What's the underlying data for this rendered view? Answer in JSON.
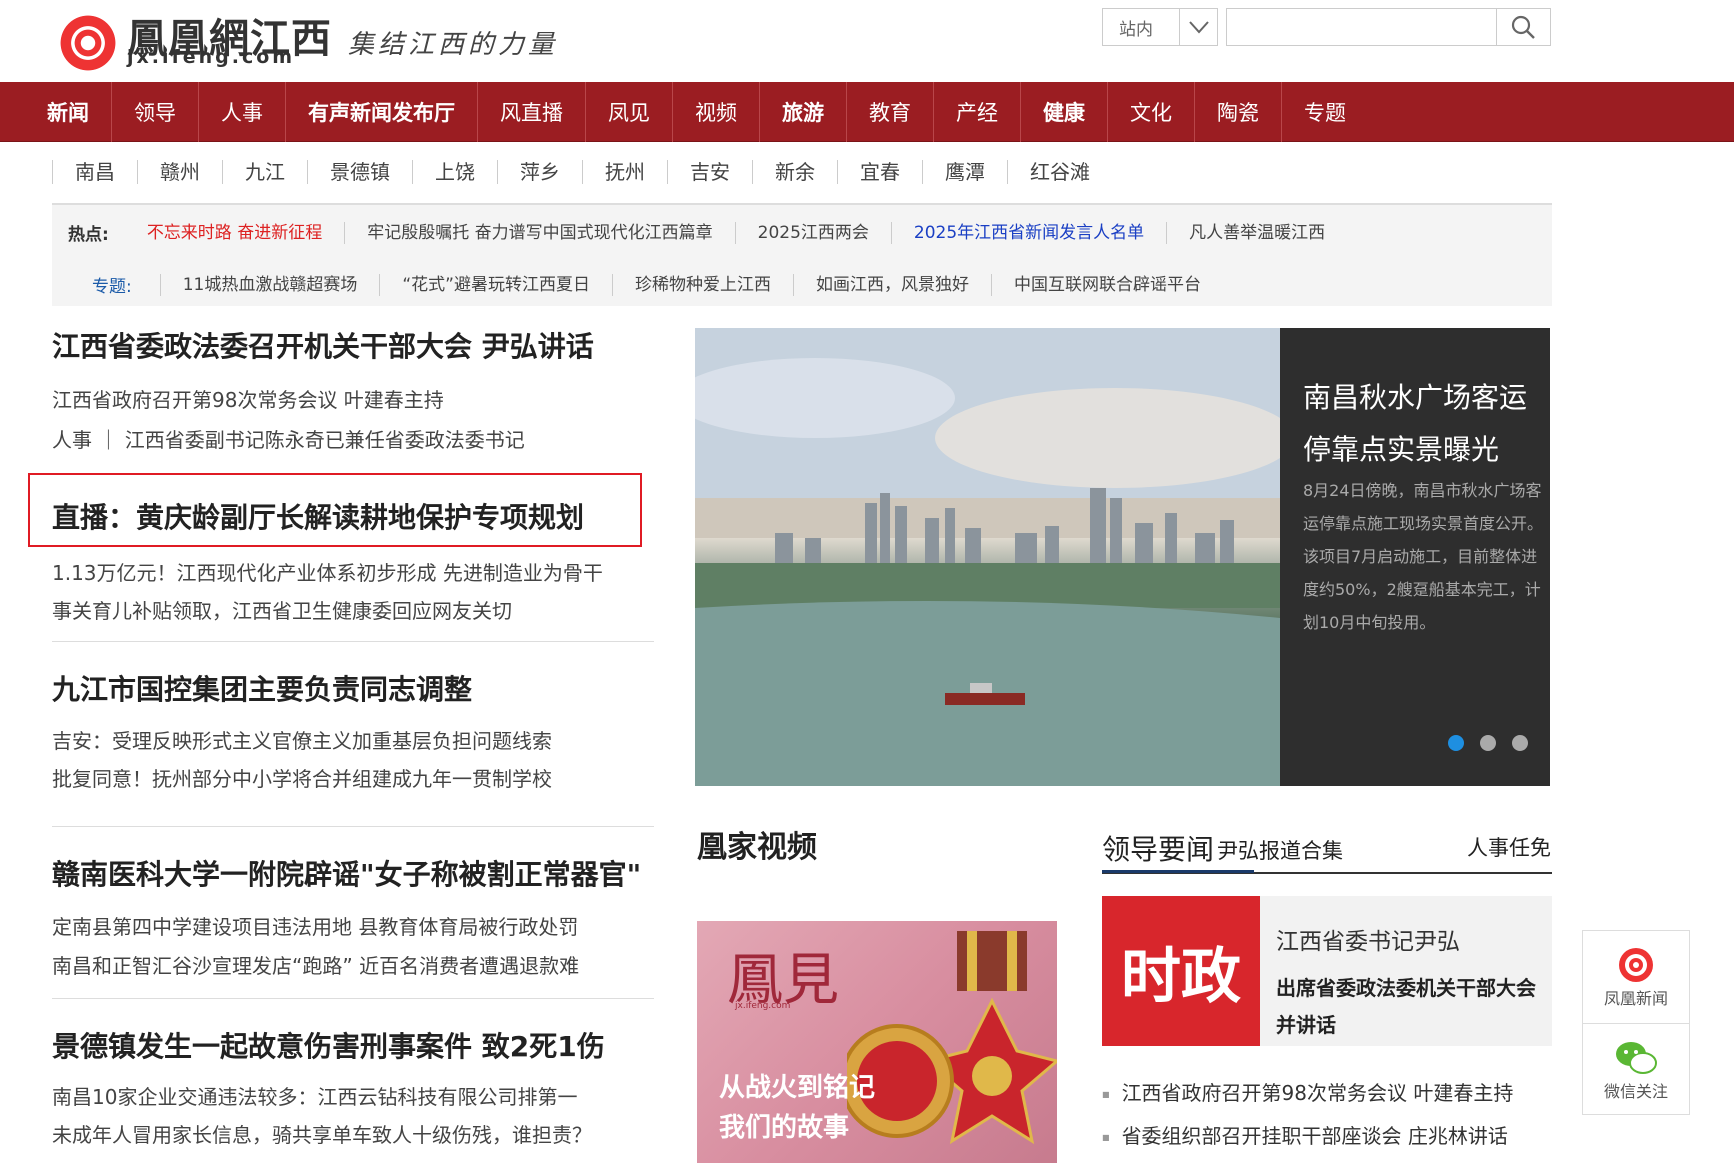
{
  "header": {
    "logo_name": "鳳凰網江西",
    "logo_domain": "jx.ifeng.com",
    "slogan": "集结江西的力量",
    "search_scope": "站内",
    "search_placeholder": ""
  },
  "main_nav": [
    {
      "label": "新闻",
      "bold": true
    },
    {
      "label": "领导",
      "bold": false
    },
    {
      "label": "人事",
      "bold": false
    },
    {
      "label": "有声新闻发布厅",
      "bold": true
    },
    {
      "label": "风直播",
      "bold": false
    },
    {
      "label": "凤见",
      "bold": false
    },
    {
      "label": "视频",
      "bold": false
    },
    {
      "label": "旅游",
      "bold": true
    },
    {
      "label": "教育",
      "bold": false
    },
    {
      "label": "产经",
      "bold": false
    },
    {
      "label": "健康",
      "bold": true
    },
    {
      "label": "文化",
      "bold": false
    },
    {
      "label": "陶瓷",
      "bold": false
    },
    {
      "label": "专题",
      "bold": false
    }
  ],
  "city_nav": [
    "南昌",
    "赣州",
    "九江",
    "景德镇",
    "上饶",
    "萍乡",
    "抚州",
    "吉安",
    "新余",
    "宜春",
    "鹰潭",
    "红谷滩"
  ],
  "hot": {
    "label": "热点:",
    "items": [
      "不忘来时路 奋进新征程",
      "牢记殷殷嘱托 奋力谱写中国式现代化江西篇章",
      "2025江西两会",
      "2025年江西省新闻发言人名单",
      "凡人善举温暖江西"
    ]
  },
  "topics": {
    "label": "专题:",
    "items": [
      "11城热血激战赣超赛场",
      "“花式”避暑玩转江西夏日",
      "珍稀物种爱上江西",
      "如画江西，风景独好",
      "中国互联网联合辟谣平台"
    ]
  },
  "news_blocks": [
    {
      "headline": "江西省委政法委召开机关干部大会 尹弘讲话",
      "subs": [
        "江西省政府召开第98次常务会议 叶建春主持",
        "人事 ｜ 江西省委副书记陈永奇已兼任省委政法委书记"
      ]
    },
    {
      "headline": "直播：黄庆龄副厅长解读耕地保护专项规划",
      "subs": [
        "1.13万亿元！江西现代化产业体系初步形成 先进制造业为骨干",
        "事关育儿补贴领取，江西省卫生健康委回应网友关切"
      ]
    },
    {
      "headline": "九江市国控集团主要负责同志调整",
      "subs": [
        "吉安：受理反映形式主义官僚主义加重基层负担问题线索",
        "批复同意！抚州部分中小学将合并组建成九年一贯制学校"
      ]
    },
    {
      "headline": "赣南医科大学一附院辟谣\"女子称被割正常器官\"",
      "subs": [
        "定南县第四中学建设项目违法用地 县教育体育局被行政处罚",
        "南昌和正智汇谷沙宣理发店“跑路” 近百名消费者遭遇退款难"
      ]
    },
    {
      "headline": "景德镇发生一起故意伤害刑事案件 致2死1伤",
      "subs": [
        "南昌10家企业交通违法较多：江西云钻科技有限公司排第一",
        "未成年人冒用家长信息，骑共享单车致人十级伤残，谁担责？"
      ]
    }
  ],
  "slider": {
    "title": "南昌秋水广场客运停靠点实景曝光",
    "desc": "8月24日傍晚，南昌市秋水广场客运停靠点施工现场实景首度公开。该项目7月启动施工，目前整体进度约50%，2艘趸船基本完工，计划10月中旬投用。",
    "active_dot": 0
  },
  "video": {
    "section_title": "凰家视频",
    "brand": "鳳見",
    "brand_domain": "jx.ifeng.com",
    "caption_1": "从战火到铭记",
    "caption_2": "我们的故事"
  },
  "leaders": {
    "title": "领导要闻",
    "sub": "尹弘报道合集",
    "more": "人事任免",
    "badge": "时政",
    "name": "江西省委书记尹弘",
    "event": "出席省委政法委机关干部大会并讲话",
    "links": [
      "江西省政府召开第98次常务会议 叶建春主持",
      "省委组织部召开挂职干部座谈会 庄兆林讲话"
    ]
  },
  "side_float": {
    "item1": "凤凰新闻",
    "item2": "微信关注"
  },
  "colors": {
    "nav_bg": "#9b1d22",
    "highlight_border": "#e01b24",
    "hot_red": "#dd2222",
    "hot_blue": "#1a3fc4",
    "badge_red": "#d8262c"
  }
}
